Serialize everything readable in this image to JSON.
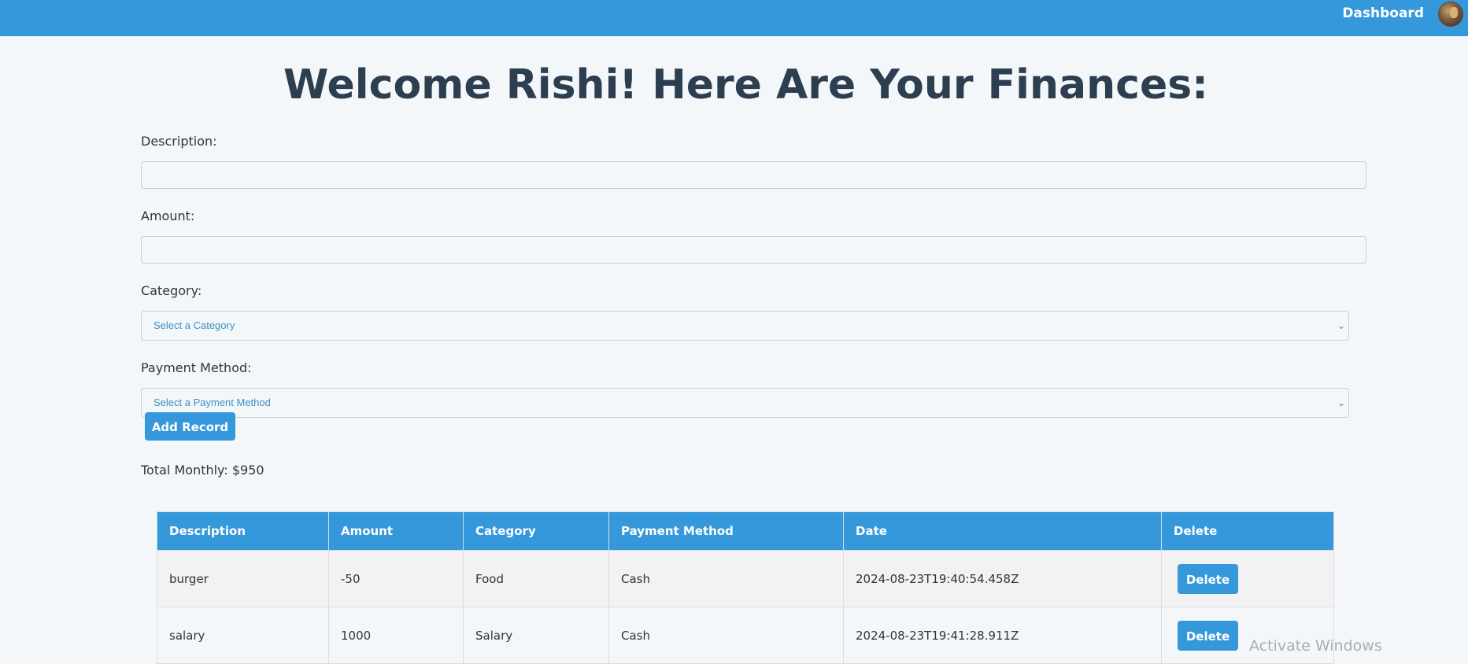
{
  "nav": {
    "dashboard_label": "Dashboard",
    "avatar_icon": "user-avatar"
  },
  "page": {
    "title": "Welcome Rishi! Here Are Your Finances:"
  },
  "form": {
    "description_label": "Description:",
    "description_value": "",
    "amount_label": "Amount:",
    "amount_value": "",
    "category_label": "Category:",
    "category_selected": "Select a Category",
    "payment_label": "Payment Method:",
    "payment_selected": "Select a Payment Method",
    "add_button": "Add Record"
  },
  "summary": {
    "total_text": "Total Monthly: $950"
  },
  "table": {
    "headers": [
      "Description",
      "Amount",
      "Category",
      "Payment Method",
      "Date",
      "Delete"
    ],
    "rows": [
      {
        "description": "burger",
        "amount": "-50",
        "category": "Food",
        "payment": "Cash",
        "date": "2024-08-23T19:40:54.458Z",
        "delete_label": "Delete"
      },
      {
        "description": "salary",
        "amount": "1000",
        "category": "Salary",
        "payment": "Cash",
        "date": "2024-08-23T19:41:28.911Z",
        "delete_label": "Delete"
      }
    ]
  },
  "os_overlay": {
    "watermark": "Activate Windows"
  },
  "colors": {
    "primary": "#3498db",
    "heading": "#2c3e50",
    "background": "#f4f7fa"
  }
}
